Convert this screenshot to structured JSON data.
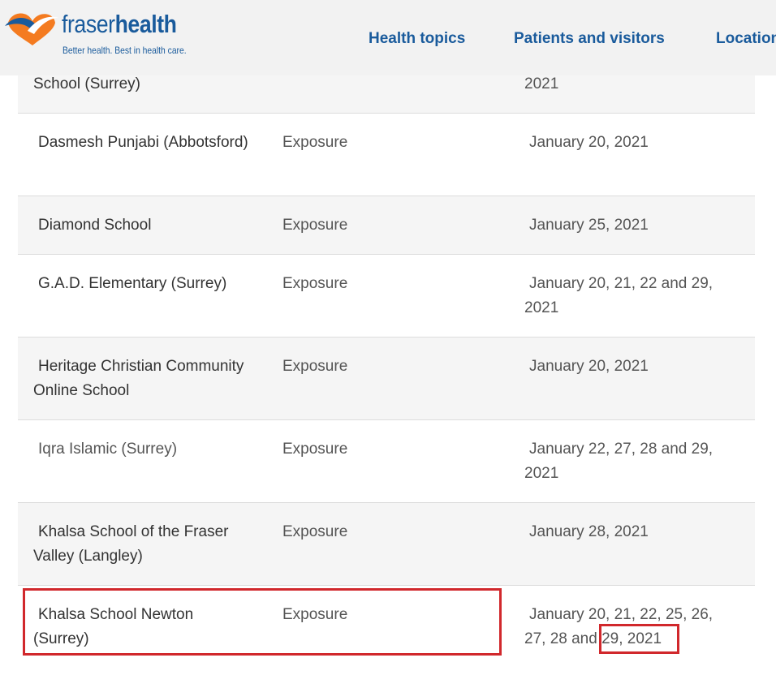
{
  "header": {
    "logo_word1": "fraser",
    "logo_word2": "health",
    "tagline": "Better health. Best in health care.",
    "nav": [
      "Health topics",
      "Patients and visitors",
      "Locations"
    ]
  },
  "rows": [
    {
      "school": "School (Surrey)",
      "type": "",
      "dates": "2021"
    },
    {
      "school": "Dasmesh Punjabi (Abbotsford)",
      "type": "Exposure",
      "dates": "January 20, 2021"
    },
    {
      "school": "Diamond School",
      "type": "Exposure",
      "dates": "January 25, 2021"
    },
    {
      "school": "G.A.D. Elementary (Surrey)",
      "type": "Exposure",
      "dates": "January 20, 21, 22 and 29, 2021"
    },
    {
      "school": "Heritage Christian Community Online School",
      "type": "Exposure",
      "dates": "January 20, 2021"
    },
    {
      "school": "Iqra Islamic (Surrey)",
      "type": "Exposure",
      "dates": "January 22, 27, 28 and 29, 2021"
    },
    {
      "school": "Khalsa School of the Fraser Valley (Langley)",
      "type": "Exposure",
      "dates": "January 28, 2021"
    },
    {
      "school": "Khalsa School Newton (Surrey)",
      "type": "Exposure",
      "dates": "January 20, 21, 22, 25, 26, 27, 28 and 29, 2021"
    }
  ],
  "colors": {
    "brand_blue": "#1a5b9c",
    "brand_orange": "#f47b20",
    "highlight_red": "#d1282c"
  }
}
